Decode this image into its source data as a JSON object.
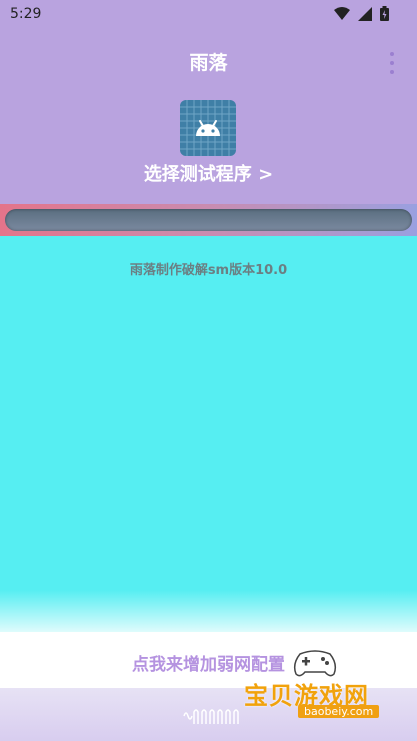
{
  "status_bar": {
    "time": "5:29",
    "icons": [
      "wifi-icon",
      "signal-icon",
      "battery-icon"
    ]
  },
  "header": {
    "title": "雨落",
    "menu_icon": "more-vert-icon"
  },
  "app_select": {
    "icon": "android-icon",
    "label": "选择测试程序 >"
  },
  "progress": {
    "value": 0
  },
  "main": {
    "version_text": "雨落制作破解sm版本10.0"
  },
  "config": {
    "label": "点我来增加弱网配置"
  },
  "watermark": {
    "text": "宝贝游戏网",
    "url": "baobeiy.com"
  },
  "colors": {
    "header_bg": "#b9a3df",
    "main_bg": "#56eef2",
    "accent": "#b593e0"
  }
}
